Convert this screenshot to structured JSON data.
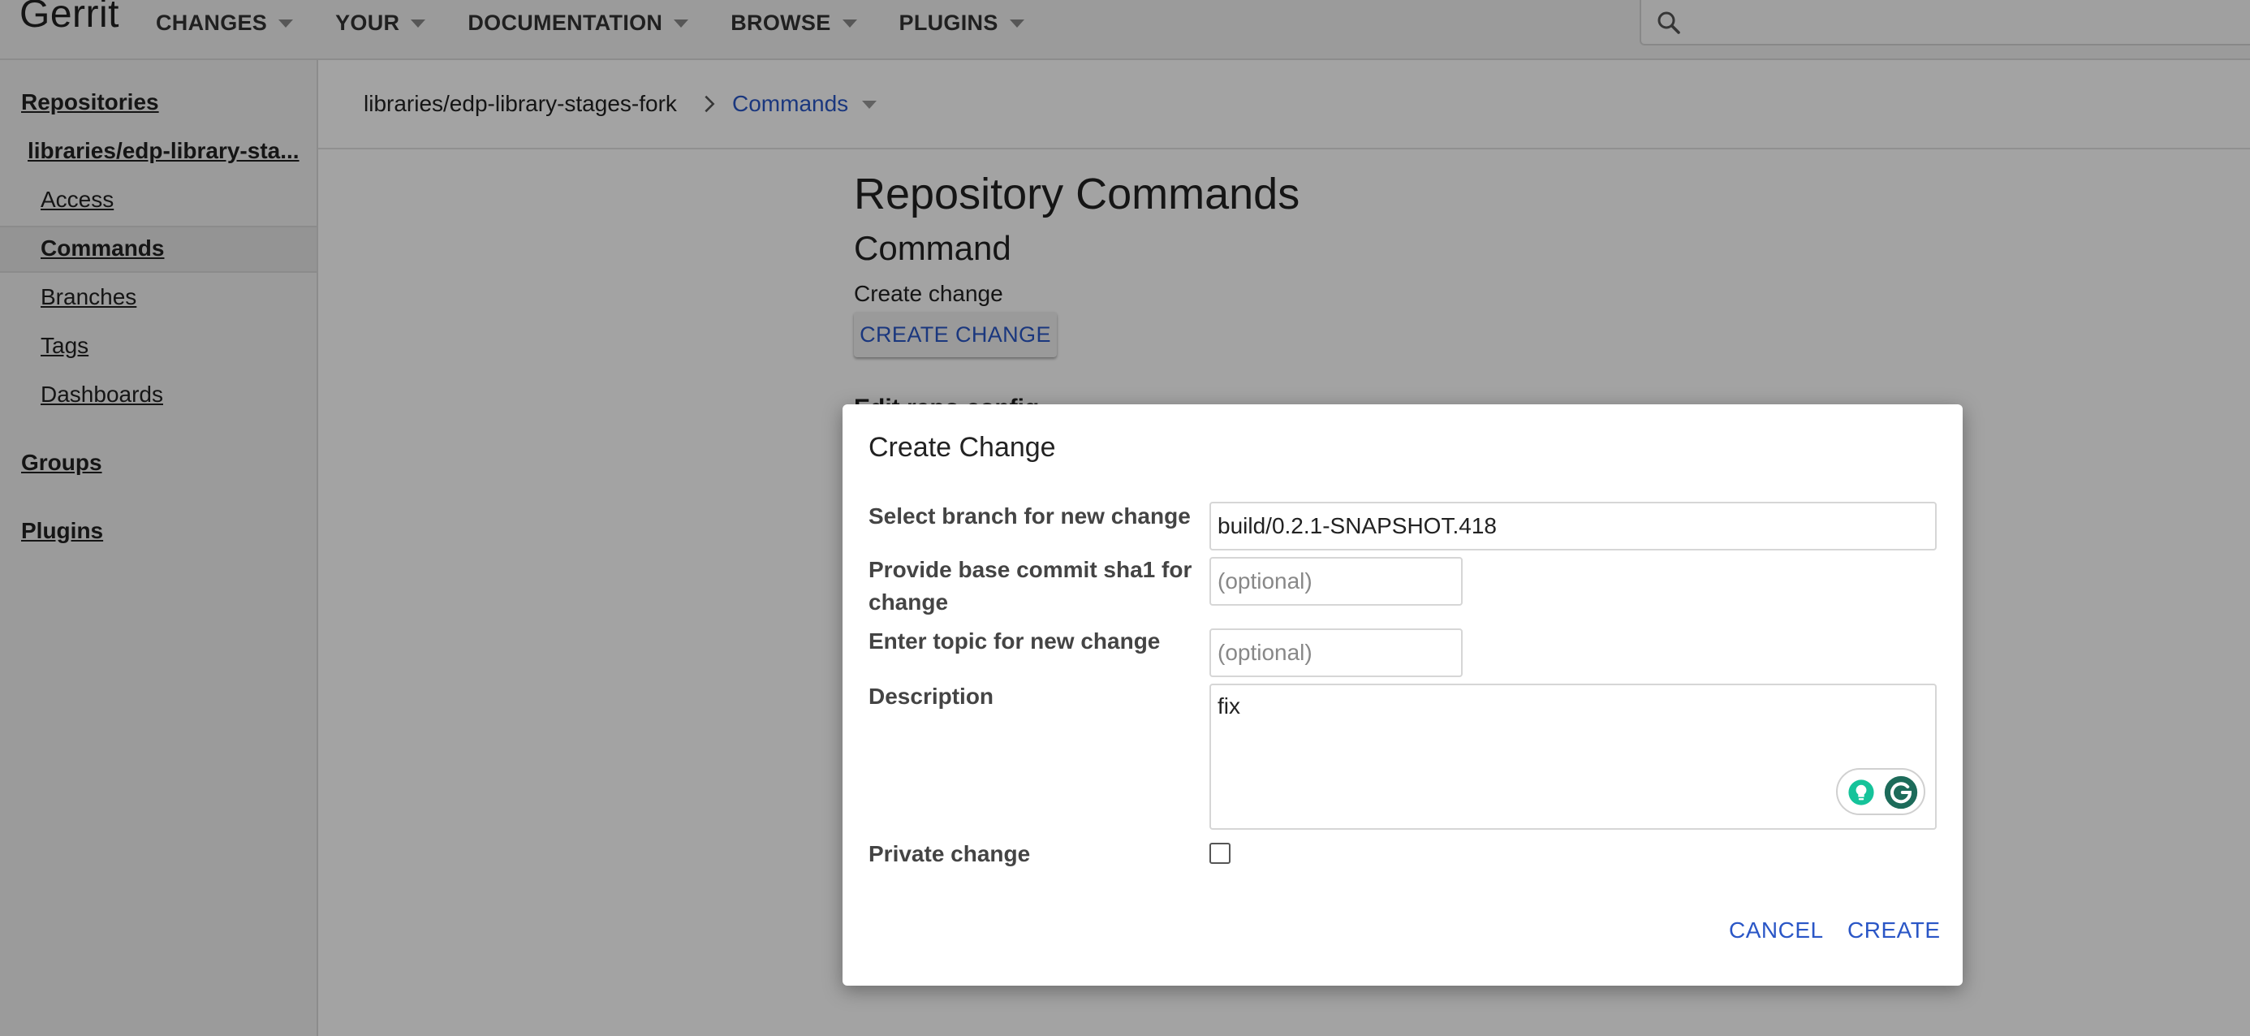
{
  "app": {
    "logo": "Gerrit"
  },
  "nav": [
    {
      "label": "CHANGES"
    },
    {
      "label": "YOUR"
    },
    {
      "label": "DOCUMENTATION"
    },
    {
      "label": "BROWSE"
    },
    {
      "label": "PLUGINS"
    }
  ],
  "search": {
    "placeholder": "",
    "icon": "search-icon"
  },
  "sidebar": {
    "repositories": "Repositories",
    "repo_name": "libraries/edp-library-sta...",
    "items": [
      {
        "label": "Access"
      },
      {
        "label": "Commands",
        "active": true
      },
      {
        "label": "Branches"
      },
      {
        "label": "Tags"
      },
      {
        "label": "Dashboards"
      }
    ],
    "groups": "Groups",
    "plugins": "Plugins"
  },
  "breadcrumb": {
    "repo": "libraries/edp-library-stages-fork",
    "current": "Commands"
  },
  "main": {
    "title": "Repository Commands",
    "subtitle": "Command",
    "create_label": "Create change",
    "create_button": "CREATE CHANGE",
    "obscured_text": "Edit repo config"
  },
  "dialog": {
    "title": "Create Change",
    "branch_label": "Select branch for new change",
    "branch_value": "build/0.2.1-SNAPSHOT.418",
    "base_label": "Provide base commit sha1 for change",
    "base_placeholder": "(optional)",
    "topic_label": "Enter topic for new change",
    "topic_placeholder": "(optional)",
    "description_label": "Description",
    "description_value": "fix",
    "private_label": "Private change",
    "private_checked": false,
    "cancel": "CANCEL",
    "create": "CREATE"
  },
  "colors": {
    "link_blue": "#2a56c6",
    "overlay": "rgba(0,0,0,0.36)",
    "grammarly_green": "#15c39a"
  }
}
